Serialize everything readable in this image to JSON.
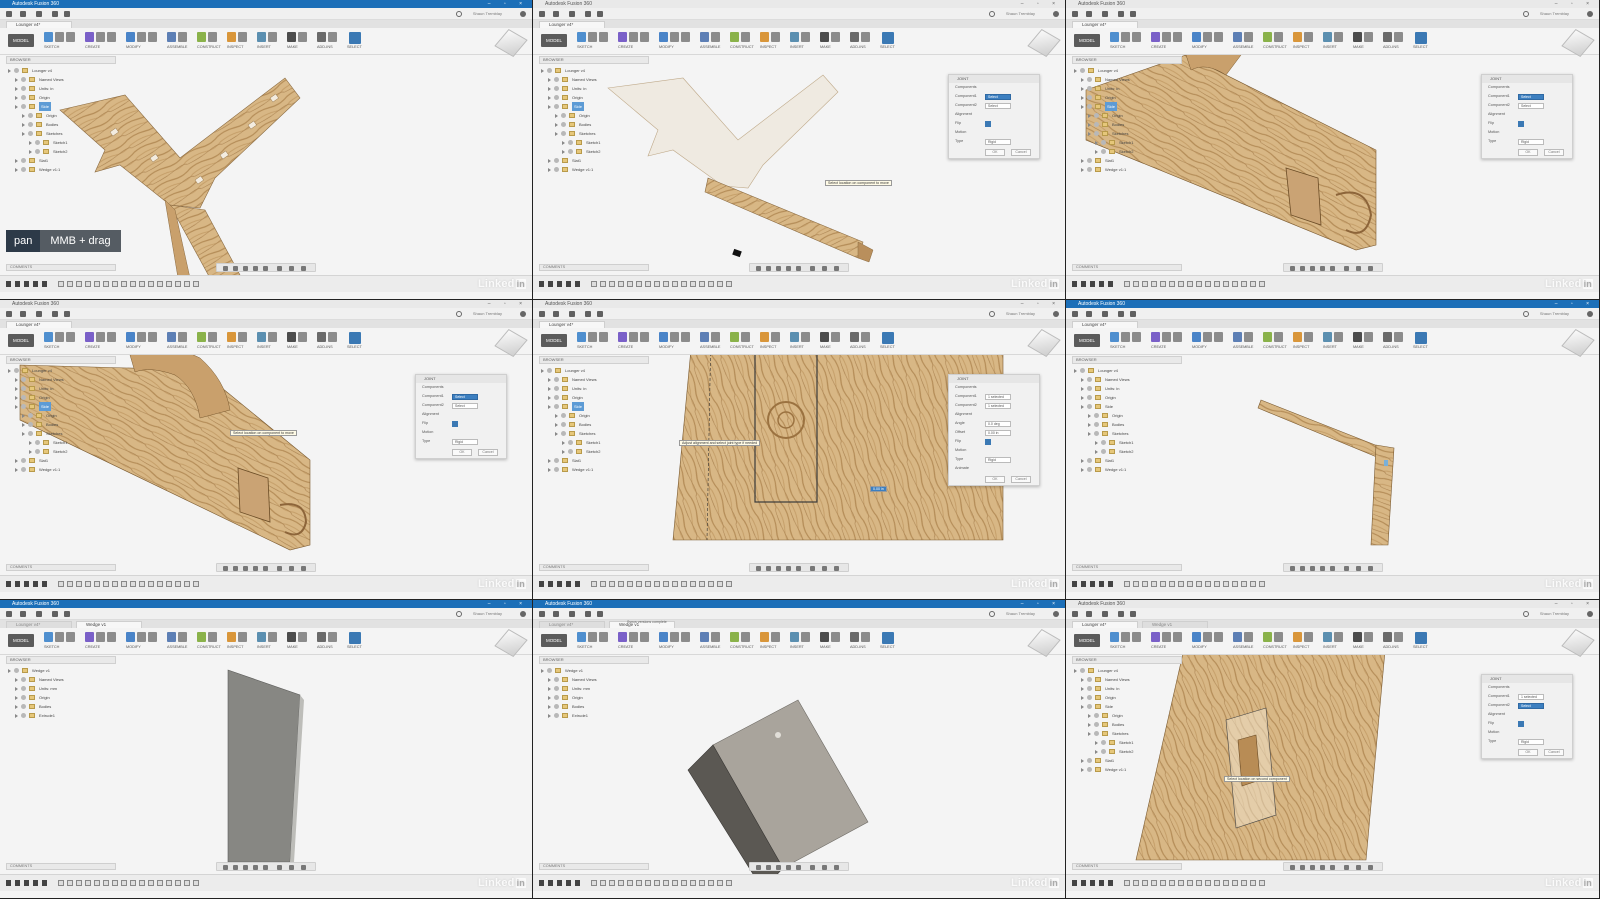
{
  "app": {
    "title": "Autodesk Fusion 360",
    "user": "Shaun Tremblay",
    "workspace": "MODEL",
    "ribbon_groups": [
      "SKETCH",
      "CREATE",
      "MODIFY",
      "ASSEMBLE",
      "CONSTRUCT",
      "INSPECT",
      "INSERT",
      "MAKE",
      "ADD-INS",
      "SELECT"
    ],
    "browser_label": "BROWSER",
    "comments_label": "COMMENTS",
    "watermark": "Linked",
    "watermark_in": "in"
  },
  "overlay": {
    "key_label": "pan",
    "action_label": "MMB + drag"
  },
  "tabs": {
    "lounger": "Lounger v4*",
    "wedge": "Wedge v1"
  },
  "tree_lounger": [
    {
      "label": "Lounger v4",
      "depth": 0,
      "hl": false
    },
    {
      "label": "Named Views",
      "depth": 1,
      "hl": false
    },
    {
      "label": "Units: in",
      "depth": 1,
      "hl": false
    },
    {
      "label": "Origin",
      "depth": 1,
      "hl": false
    },
    {
      "label": "Side",
      "depth": 1,
      "hl": true
    },
    {
      "label": "Origin",
      "depth": 2,
      "hl": false
    },
    {
      "label": "Bodies",
      "depth": 2,
      "hl": false
    },
    {
      "label": "Sketches",
      "depth": 2,
      "hl": false
    },
    {
      "label": "Sketch1",
      "depth": 3,
      "hl": false
    },
    {
      "label": "Sketch2",
      "depth": 3,
      "hl": false
    },
    {
      "label": "Slat1",
      "depth": 1,
      "hl": false
    },
    {
      "label": "Wedge v1:1",
      "depth": 1,
      "hl": false
    }
  ],
  "tree_wedge": [
    {
      "label": "Wedge v1",
      "depth": 0,
      "hl": false
    },
    {
      "label": "Named Views",
      "depth": 1,
      "hl": false
    },
    {
      "label": "Units: mm",
      "depth": 1,
      "hl": false
    },
    {
      "label": "Origin",
      "depth": 1,
      "hl": false
    },
    {
      "label": "Bodies",
      "depth": 1,
      "hl": false
    },
    {
      "label": "Extrude1",
      "depth": 1,
      "hl": false
    }
  ],
  "joint": {
    "title": "JOINT",
    "components_header": "Components",
    "component1_label": "Component1",
    "component2_label": "Component2",
    "select_value": "Select",
    "selected_value": "1 selected",
    "alignment_header": "Alignment",
    "flip_label": "Flip",
    "angle_label": "Angle",
    "angle_value": "0.0 deg",
    "offset_label": "Offset",
    "offset_value": "0.00 in",
    "motion_header": "Motion",
    "type_label": "Type",
    "type_value": "Rigid",
    "animate_label": "Animate",
    "ok_label": "OK",
    "cancel_label": "Cancel"
  },
  "tooltips": {
    "select_location": "Select location on component to move",
    "adjust_alignment": "Adjust alignment and select joint type if needed",
    "select_second": "Select location on second component",
    "input_value": "0.00 in"
  },
  "status": {
    "sync_message": "Syncs versions complete"
  },
  "colors": {
    "accent": "#1c6fb8",
    "wood_light": "#d9b98a",
    "wood_dark": "#a97f4c",
    "solid_gray": "#8a8a86"
  }
}
